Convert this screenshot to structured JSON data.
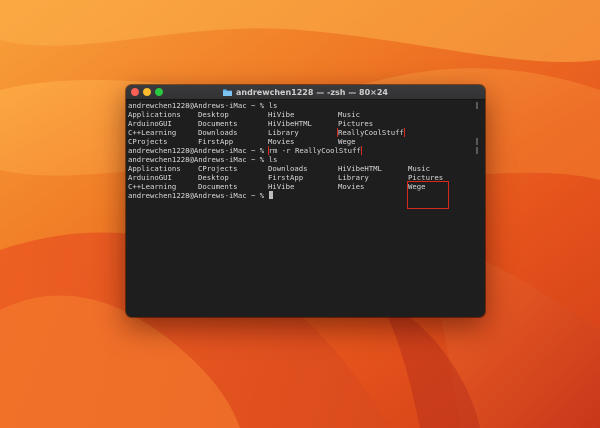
{
  "window": {
    "title": "andrewchen1228 — -zsh — 80×24"
  },
  "terminal": {
    "prompt": "andrewchen1228@Andrews-iMac ~ % ",
    "commands": {
      "first": "ls",
      "second": "rm -r ReallyCoolStuff",
      "third": "ls"
    },
    "listing1": [
      [
        "Applications",
        "Desktop",
        "HiVibe",
        "Music"
      ],
      [
        "ArduinoGUI",
        "Documents",
        "HiVibeHTML",
        "Pictures"
      ],
      [
        "C++Learning",
        "Downloads",
        "Library",
        "ReallyCoolStuff"
      ],
      [
        "CProjects",
        "FirstApp",
        "Movies",
        "Wege"
      ]
    ],
    "listing2": [
      [
        "Applications",
        "CProjects",
        "Downloads",
        "HiVibeHTML",
        "Music"
      ],
      [
        "ArduinoGUI",
        "Desktop",
        "FirstApp",
        "Library",
        "Pictures"
      ],
      [
        "C++Learning",
        "Documents",
        "HiVibe",
        "Movies",
        "Wege"
      ]
    ]
  },
  "colors": {
    "highlight": "#d6291f",
    "terminal_bg": "#1e1e1e",
    "terminal_text": "#d9d9d9"
  },
  "icons": {
    "title_icon": "folder-icon"
  }
}
